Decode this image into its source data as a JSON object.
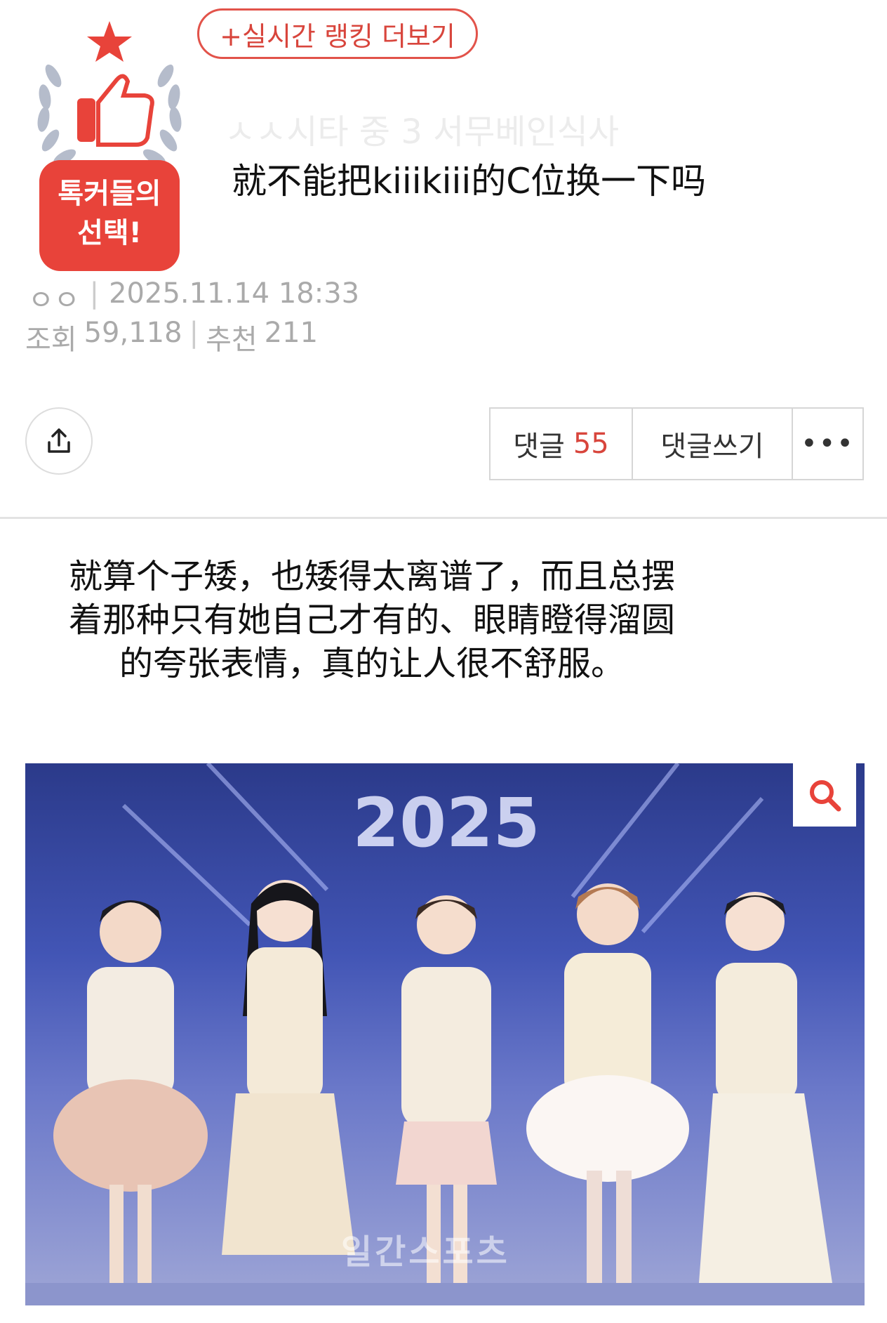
{
  "header": {
    "ranking_link": "+실시간 랭킹 더보기",
    "badge": {
      "line1": "톡커들의",
      "line2": "선택!"
    },
    "ghost_title": "ㅅㅅ시타 중 3 서무베인식사",
    "title": "就不能把kiiikiii的C位换一下吗"
  },
  "meta": {
    "author": "ㅇㅇ",
    "datetime": "2025.11.14 18:33",
    "views_label": "조회",
    "views": "59,118",
    "recommend_label": "추천",
    "recommend": "211"
  },
  "actions": {
    "comments_label": "댓글",
    "comments_count": "55",
    "write_label": "댓글쓰기",
    "more_label": "•••"
  },
  "body": {
    "line1": "就算个子矮，也矮得太离谱了，而且总摆",
    "line2": "着那种只有她自己才有的、眼睛瞪得溜圆",
    "line3": "的夸张表情，真的让人很不舒服。"
  },
  "photo": {
    "year_text": "2025",
    "watermark": "일간스포츠"
  },
  "colors": {
    "accent": "#e8433a",
    "link_red": "#d8453c",
    "meta_gray": "#aaaaaa"
  }
}
